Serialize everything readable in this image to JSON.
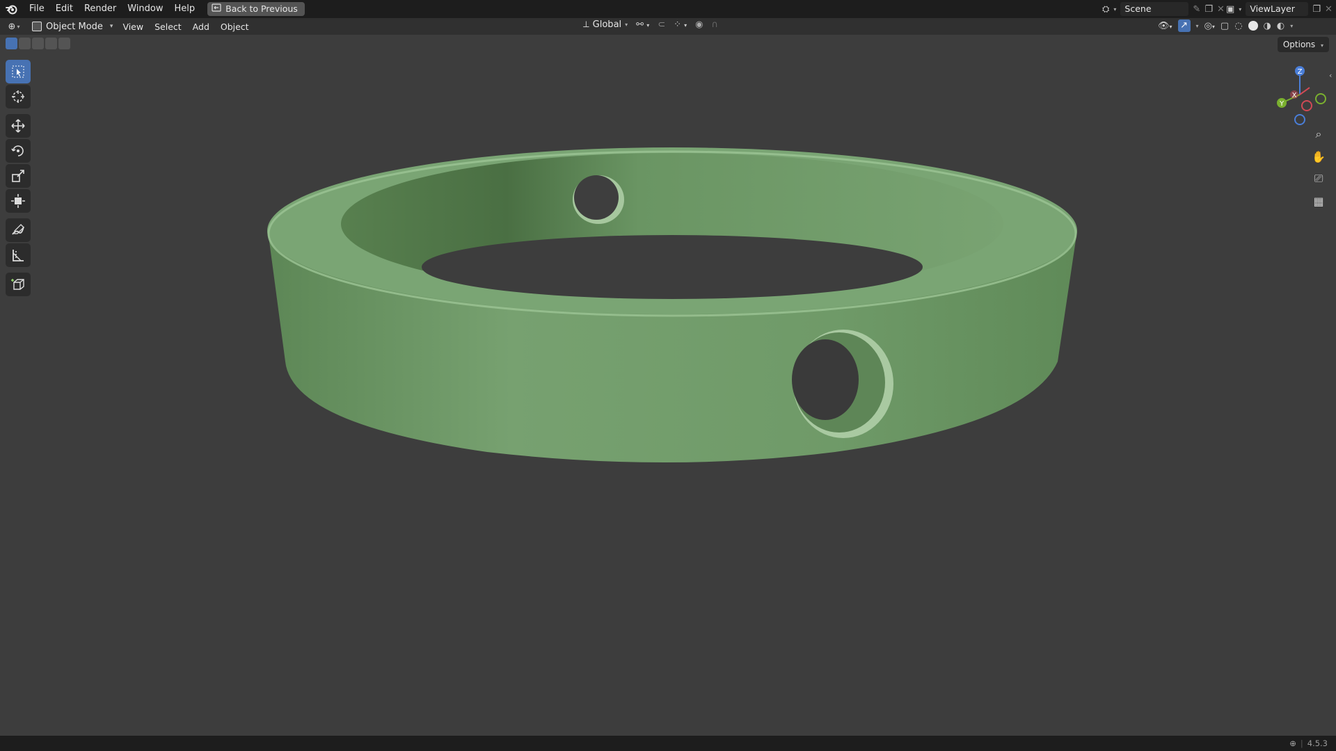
{
  "topbar": {
    "menus": [
      "File",
      "Edit",
      "Render",
      "Window",
      "Help"
    ],
    "back_button": "Back to Previous",
    "scene": "Scene",
    "view_layer": "ViewLayer"
  },
  "header": {
    "mode": "Object Mode",
    "menus": [
      "View",
      "Select",
      "Add",
      "Object"
    ],
    "transform_orientation": "Global"
  },
  "viewport": {
    "options_label": "Options",
    "gizmo": {
      "z": "Z",
      "x": "X",
      "y": "Y"
    },
    "model_color": "#6f9a68"
  },
  "toolbar": {
    "tools": [
      "select-box",
      "cursor",
      "move",
      "rotate",
      "scale",
      "transform",
      "annotate",
      "measure",
      "add-cube"
    ]
  },
  "statusbar": {
    "version": "4.5.3"
  }
}
